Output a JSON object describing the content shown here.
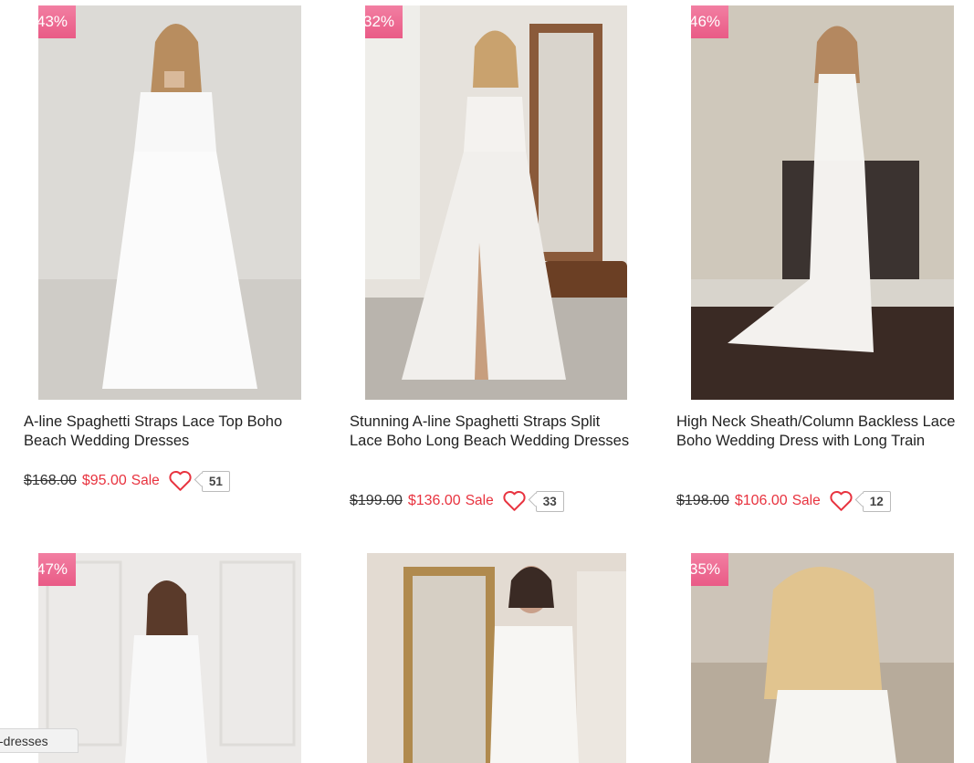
{
  "products": [
    {
      "discount": "43%",
      "title": "A-line Spaghetti Straps Lace Top Boho Beach Wedding Dresses",
      "old_price": "$168.00",
      "new_price": "$95.00",
      "sale_label": "Sale",
      "like_count": "51"
    },
    {
      "discount": "32%",
      "title": "Stunning A-line Spaghetti Straps Split Lace Boho Long Beach Wedding Dresses",
      "old_price": "$199.00",
      "new_price": "$136.00",
      "sale_label": "Sale",
      "like_count": "33"
    },
    {
      "discount": "46%",
      "title": "High Neck Sheath/Column Backless Lace Boho Wedding Dress with Long Train",
      "old_price": "$198.00",
      "new_price": "$106.00",
      "sale_label": "Sale",
      "like_count": "12"
    },
    {
      "discount": "47%"
    },
    {
      "discount": ""
    },
    {
      "discount": "35%"
    }
  ],
  "status_tooltip": "-dresses",
  "colors": {
    "badge": "#ee6f97",
    "sale_price": "#e8333f",
    "heart": "#e8333f"
  },
  "icons": {
    "like": "heart-outline-icon"
  }
}
